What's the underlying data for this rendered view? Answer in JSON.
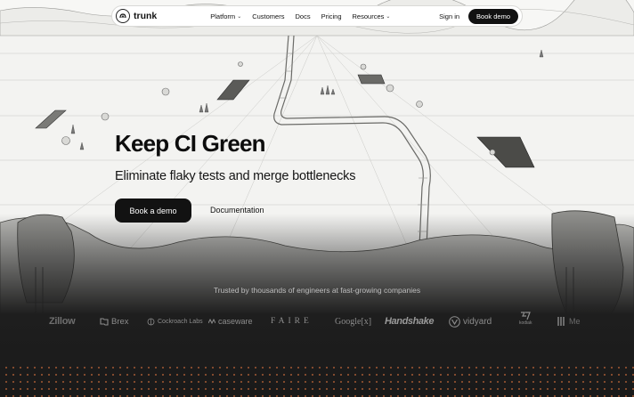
{
  "nav": {
    "logo": "trunk",
    "links": [
      {
        "label": "Platform",
        "dropdown": true
      },
      {
        "label": "Customers",
        "dropdown": false
      },
      {
        "label": "Docs",
        "dropdown": false
      },
      {
        "label": "Pricing",
        "dropdown": false
      },
      {
        "label": "Resources",
        "dropdown": true
      }
    ],
    "signin": "Sign in",
    "book_demo": "Book demo"
  },
  "hero": {
    "title": "Keep CI Green",
    "subtitle": "Eliminate flaky tests and merge bottlenecks",
    "primary_cta": "Book a demo",
    "secondary_cta": "Documentation"
  },
  "trusted": {
    "text": "Trusted by thousands of engineers at fast-growing companies",
    "logos": [
      "Zillow",
      "Brex",
      "Cockroach Labs",
      "caseware",
      "FAIRE",
      "Google[x]",
      "Handshake",
      "vidyard",
      "kodiak",
      "Me"
    ]
  },
  "colors": {
    "accent_dots": "#d6703c",
    "cta_bg": "#121212",
    "dark_band": "#1e1e1e"
  }
}
